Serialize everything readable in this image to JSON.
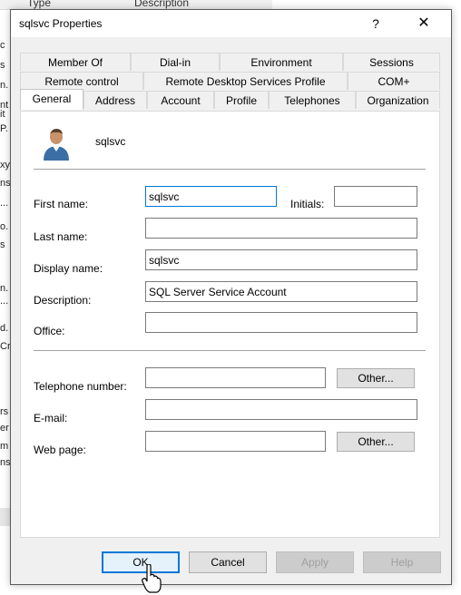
{
  "background": {
    "headers": [
      "Type",
      "Description"
    ],
    "fragments": [
      "c",
      "s",
      "n.",
      "nt",
      "it",
      "P.",
      "xy",
      "ns",
      "...",
      "o.",
      "s",
      "n.",
      "...",
      "d.",
      "Cr",
      "rs",
      "er",
      "m",
      "ns"
    ]
  },
  "dialog": {
    "title": "sqlsvc Properties",
    "help_label": "?",
    "close_label": "✕",
    "user_icon": "user-icon",
    "user_name": "sqlsvc"
  },
  "tabs": {
    "row1": [
      "Member Of",
      "Dial-in",
      "Environment",
      "Sessions"
    ],
    "row2": [
      "Remote control",
      "Remote Desktop Services Profile",
      "COM+"
    ],
    "row3": [
      "General",
      "Address",
      "Account",
      "Profile",
      "Telephones",
      "Organization"
    ],
    "active": "General"
  },
  "form": {
    "first_name": {
      "label": "First name:",
      "value": "sqlsvc"
    },
    "initials": {
      "label": "Initials:",
      "value": ""
    },
    "last_name": {
      "label": "Last name:",
      "value": ""
    },
    "display_name": {
      "label": "Display name:",
      "value": "sqlsvc"
    },
    "description": {
      "label": "Description:",
      "value": "SQL Server Service Account"
    },
    "office": {
      "label": "Office:",
      "value": ""
    },
    "telephone": {
      "label": "Telephone number:",
      "value": "",
      "other_label": "Other..."
    },
    "email": {
      "label": "E-mail:",
      "value": ""
    },
    "web_page": {
      "label": "Web page:",
      "value": "",
      "other_label": "Other..."
    }
  },
  "buttons": {
    "ok": "OK",
    "cancel": "Cancel",
    "apply": "Apply",
    "help": "Help"
  },
  "colors": {
    "focus_border": "#0078d7",
    "dialog_bg": "#f0f0f0"
  }
}
